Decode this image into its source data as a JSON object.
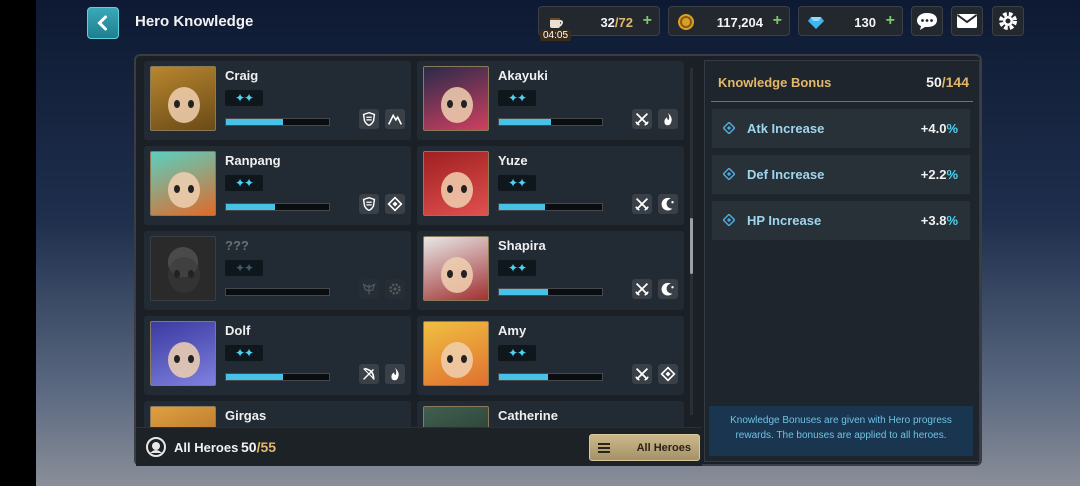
{
  "header": {
    "title": "Hero Knowledge"
  },
  "resources": {
    "stamina": {
      "value": "32",
      "max": "72",
      "timer": "04:05"
    },
    "gold": {
      "value": "117,204"
    },
    "gems": {
      "value": "130"
    }
  },
  "heroes": [
    {
      "name": "Craig",
      "stars": "✦✦",
      "progress": 0.55,
      "classes": [
        "shield-icon",
        "mountain-icon"
      ]
    },
    {
      "name": "Akayuki",
      "stars": "✦✦",
      "progress": 0.5,
      "classes": [
        "crossed-swords-icon",
        "flame-icon"
      ]
    },
    {
      "name": "Ranpang",
      "stars": "✦✦",
      "progress": 0.48,
      "classes": [
        "shield-icon",
        "diamond-icon"
      ]
    },
    {
      "name": "Yuze",
      "stars": "✦✦",
      "progress": 0.45,
      "classes": [
        "crossed-swords-icon",
        "crescent-icon"
      ]
    },
    {
      "name": "???",
      "stars": "✦✦",
      "progress": 0.0,
      "locked": true,
      "classes": [
        "wings-icon",
        "gear-icon"
      ]
    },
    {
      "name": "Shapira",
      "stars": "✦✦",
      "progress": 0.48,
      "classes": [
        "crossed-swords-icon",
        "crescent-icon"
      ]
    },
    {
      "name": "Dolf",
      "stars": "✦✦",
      "progress": 0.55,
      "classes": [
        "bow-icon",
        "flame-icon"
      ]
    },
    {
      "name": "Amy",
      "stars": "✦✦",
      "progress": 0.48,
      "classes": [
        "crossed-swords-icon",
        "diamond-icon"
      ]
    },
    {
      "name": "Girgas",
      "stars": "",
      "progress": 0.0,
      "classes": []
    },
    {
      "name": "Catherine",
      "stars": "",
      "progress": 0.0,
      "classes": []
    }
  ],
  "footer": {
    "label": "All Heroes",
    "count": "50",
    "max": "55",
    "filter_label": "All Heroes"
  },
  "bonus": {
    "title": "Knowledge Bonus",
    "count": "50",
    "max": "144",
    "rows": [
      {
        "label": "Atk Increase",
        "value": "+4.0",
        "unit": "%"
      },
      {
        "label": "Def Increase",
        "value": "+2.2",
        "unit": "%"
      },
      {
        "label": "HP Increase",
        "value": "+3.8",
        "unit": "%"
      }
    ],
    "note": "Knowledge Bonuses are given with Hero progress rewards. The bonuses are applied to all heroes."
  },
  "colors": {
    "accent_gold": "#e3b86a",
    "accent_cyan": "#4fd1f2",
    "progress": "#45c2e6",
    "back_button": "#2a95a6"
  }
}
